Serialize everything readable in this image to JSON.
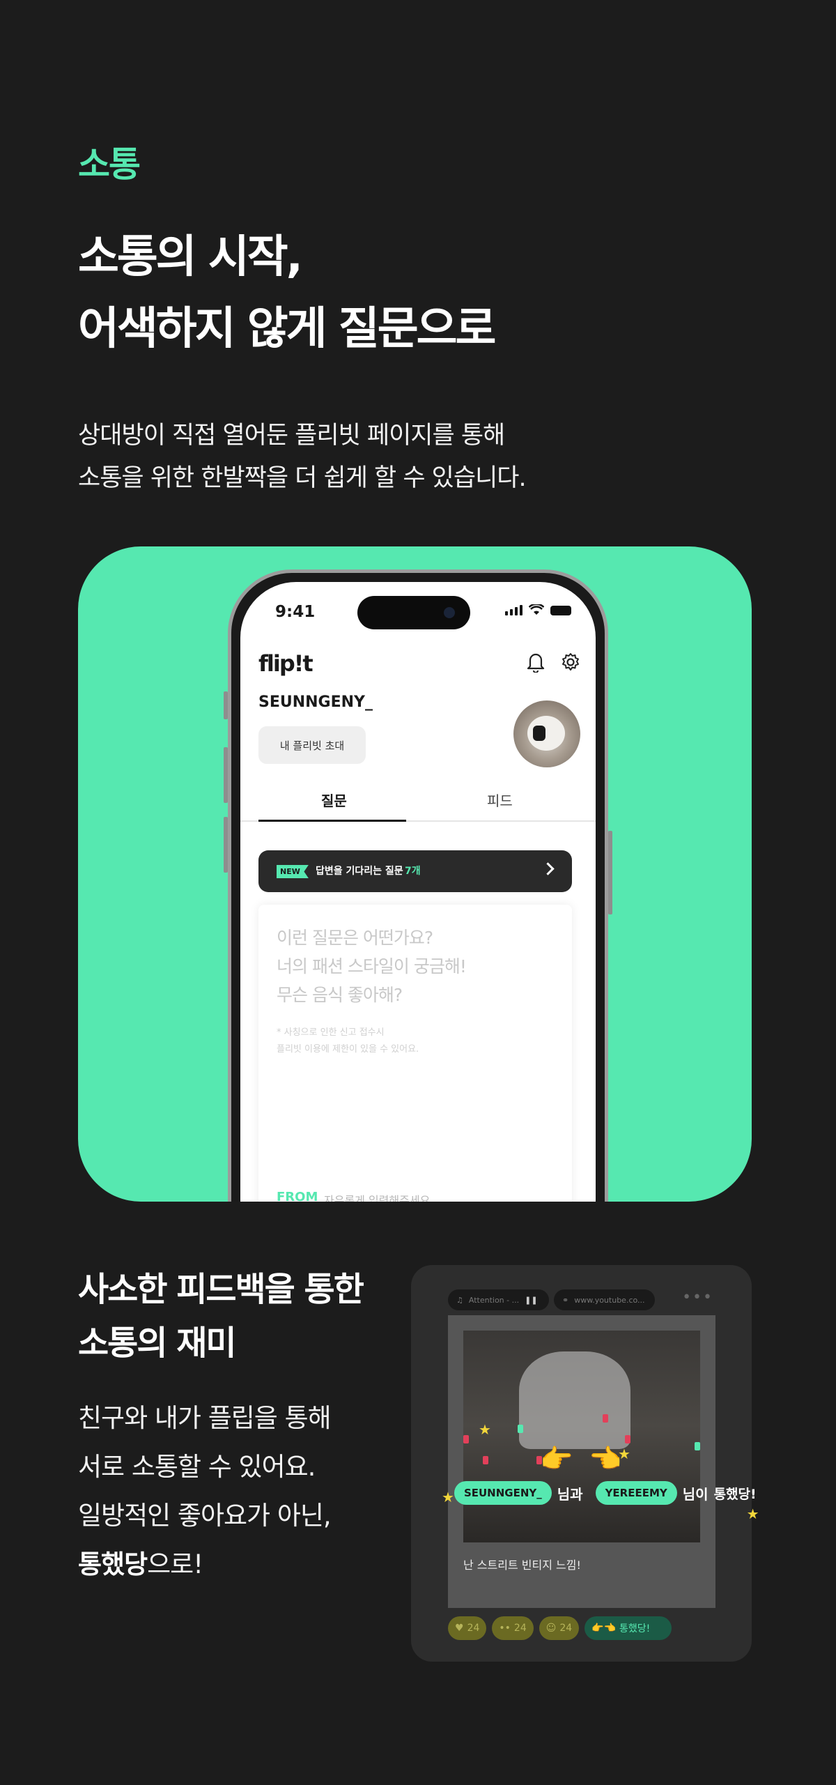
{
  "section": {
    "label": "소통",
    "title_line1": "소통의 시작,",
    "title_line2": "어색하지 않게 질문으로",
    "desc_line1": "상대방이 직접 열어둔 플리빗 페이지를 통해",
    "desc_line2": "소통을 위한 한발짝을 더 쉽게 할 수 있습니다."
  },
  "phone": {
    "status_time": "9:41",
    "app_logo": "flip!t",
    "username": "SEUNNGENY_",
    "invite_button": "내 플리빗 초대",
    "tabs": [
      "질문",
      "피드"
    ],
    "pending": {
      "badge": "NEW",
      "text": "답변을 기다리는 질문",
      "count": "7개"
    },
    "question_card": {
      "placeholder_lines": [
        "이런 질문은 어떤가요?",
        "너의 패션 스타일이 궁금해!",
        "무슨 음식 좋아해?"
      ],
      "notice_lines": [
        "* 사칭으로 인한 신고 접수시",
        "플리빗 이용에 제한이 있을 수 있어요."
      ],
      "from_label": "FROM",
      "from_placeholder": "자유롭게 입력해주세요"
    }
  },
  "section2": {
    "title_line1": "사소한 피드백을 통한",
    "title_line2": "소통의 재미",
    "desc_line1": "친구와 내가 플립을 통해",
    "desc_line2": "서로 소통할 수 있어요.",
    "desc_line3": "일방적인 좋아요가 아닌,",
    "desc_bold": "통했당",
    "desc_tail": "으로!"
  },
  "preview": {
    "music_chip": "Attention - ...",
    "link_chip": "www.youtube.co...",
    "user_a": "SEUNNGENY_",
    "connector": "님과",
    "user_b": "YEREEEMY",
    "connector2": "님이",
    "result": "통했당!",
    "caption": "난 스트리트 빈티지 느낌!",
    "reactions": [
      {
        "icon": "heart-icon",
        "glyph": "♥",
        "count": "24"
      },
      {
        "icon": "eyes-icon",
        "glyph": "••",
        "count": "24"
      },
      {
        "icon": "smile-icon",
        "glyph": "☺",
        "count": "24"
      }
    ],
    "flip_chip": "통했당!"
  },
  "colors": {
    "accent": "#56e8b0",
    "background": "#1c1c1c"
  }
}
